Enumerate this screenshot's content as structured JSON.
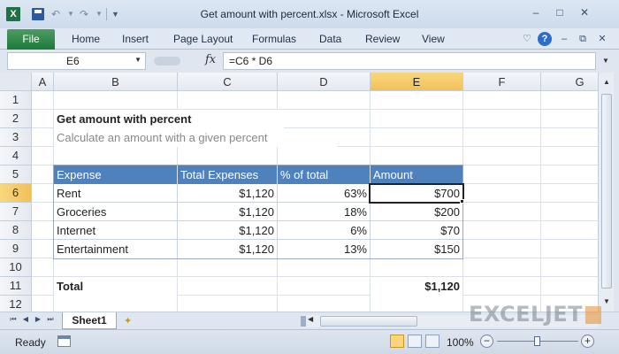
{
  "window": {
    "title": "Get amount with percent.xlsx  -  Microsoft Excel",
    "app_icon_letter": "X",
    "controls": {
      "minimize": "–",
      "maximize": "□",
      "close": "✕"
    }
  },
  "quick_access": {
    "undo": "↶",
    "redo": "↷",
    "dropdown": "▼",
    "customize": "▼"
  },
  "ribbon": {
    "file_tab": "File",
    "tabs": [
      "Home",
      "Insert",
      "Page Layout",
      "Formulas",
      "Data",
      "Review",
      "View"
    ],
    "controls": {
      "collapse": "♡",
      "help": "?",
      "minimize": "–",
      "restore": "⧉",
      "close": "✕"
    }
  },
  "formula_bar": {
    "name_box": "E6",
    "name_box_arrow": "▼",
    "fx": "fx",
    "formula": "=C6 * D6",
    "expand": "▼"
  },
  "grid": {
    "columns": [
      "A",
      "B",
      "C",
      "D",
      "E",
      "F",
      "G"
    ],
    "selected_column": "E",
    "rows": [
      "1",
      "2",
      "3",
      "4",
      "5",
      "6",
      "7",
      "8",
      "9",
      "10",
      "11",
      "12"
    ],
    "selected_row": "6",
    "active_cell": "E6"
  },
  "sheet": {
    "title": "Get amount with percent",
    "subtitle": "Calculate an amount with a given percent",
    "table": {
      "headers": [
        "Expense",
        "Total Expenses",
        "% of total",
        "Amount"
      ],
      "rows": [
        [
          "Rent",
          "$1,120",
          "63%",
          "$700"
        ],
        [
          "Groceries",
          "$1,120",
          "18%",
          "$200"
        ],
        [
          "Internet",
          "$1,120",
          "6%",
          "$70"
        ],
        [
          "Entertainment",
          "$1,120",
          "13%",
          "$150"
        ]
      ]
    },
    "total_label": "Total",
    "total_value": "$1,120"
  },
  "sheet_tabs": {
    "nav": [
      "⏮",
      "◀",
      "▶",
      "⏭"
    ],
    "active": "Sheet1",
    "new_sheet_icon": "new-sheet-icon"
  },
  "scroll": {
    "up": "▲",
    "down": "▼",
    "left": "◀"
  },
  "watermark": "EXCELJET",
  "status_bar": {
    "status": "Ready",
    "zoom": "100%",
    "zoom_minus": "−",
    "zoom_plus": "+"
  },
  "colors": {
    "header_fill": "#4f81bd",
    "file_tab": "#1d7a3a",
    "selection_header": "#f1c15a"
  }
}
